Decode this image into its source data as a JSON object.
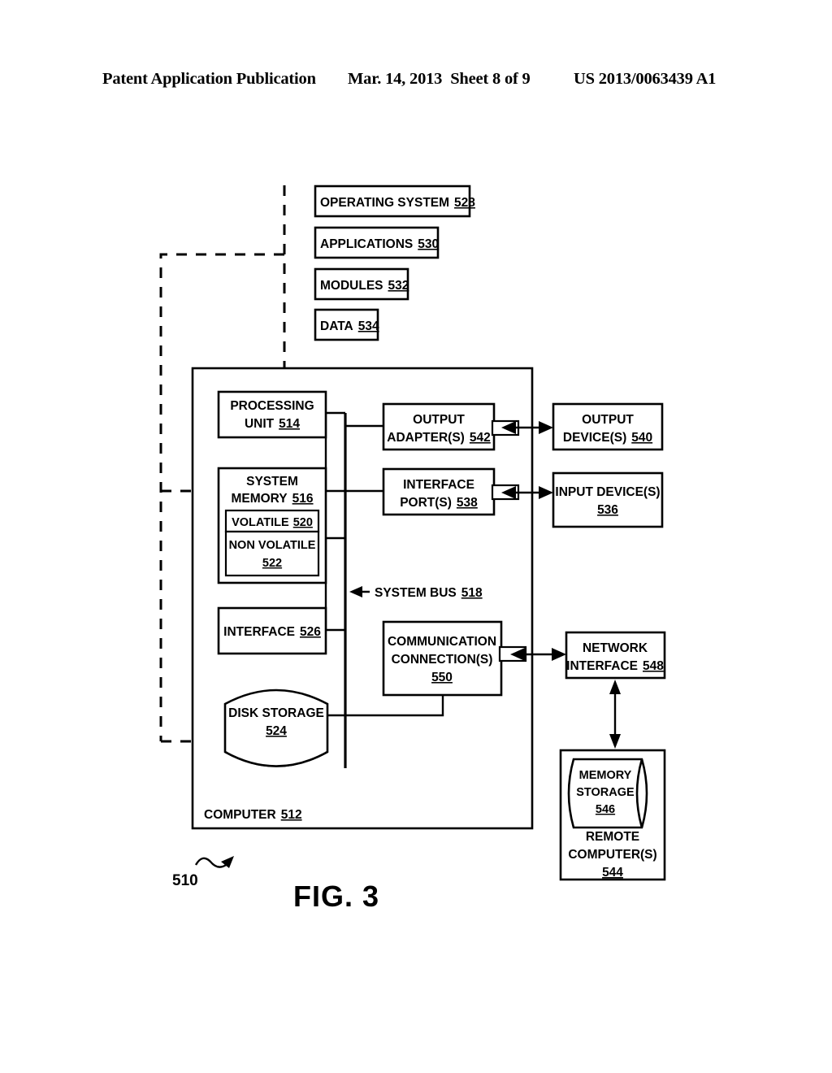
{
  "header": {
    "left": "Patent Application Publication",
    "date": "Mar. 14, 2013",
    "sheet": "Sheet 8 of 9",
    "publication_number": "US 2013/0063439 A1"
  },
  "figure": {
    "caption": "FIG. 3",
    "system_ref": "510",
    "bus_label": "SYSTEM BUS",
    "bus_ref": "518",
    "computer_label": "COMPUTER",
    "computer_ref": "512"
  },
  "software_blocks": [
    {
      "label": "OPERATING SYSTEM",
      "ref": "528"
    },
    {
      "label": "APPLICATIONS",
      "ref": "530"
    },
    {
      "label": "MODULES",
      "ref": "532"
    },
    {
      "label": "DATA",
      "ref": "534"
    }
  ],
  "computer_blocks": {
    "processing_unit": {
      "line1": "PROCESSING",
      "line2": "UNIT",
      "ref": "514"
    },
    "system_memory": {
      "line1": "SYSTEM",
      "line2": "MEMORY",
      "ref": "516"
    },
    "volatile": {
      "label": "VOLATILE",
      "ref": "520"
    },
    "non_volatile": {
      "line1": "NON VOLATILE",
      "ref": "522"
    },
    "interface": {
      "label": "INTERFACE",
      "ref": "526"
    },
    "disk_storage": {
      "label": "DISK STORAGE",
      "ref": "524"
    },
    "output_adapters": {
      "line1": "OUTPUT",
      "line2": "ADAPTER(S)",
      "ref": "542"
    },
    "interface_ports": {
      "line1": "INTERFACE",
      "line2": "PORT(S)",
      "ref": "538"
    },
    "communication_connections": {
      "line1": "COMMUNICATION",
      "line2": "CONNECTION(S)",
      "ref": "550"
    }
  },
  "external_blocks": {
    "output_devices": {
      "line1": "OUTPUT",
      "line2": "DEVICE(S)",
      "ref": "540"
    },
    "input_devices": {
      "line1": "INPUT DEVICE(S)",
      "ref": "536"
    },
    "network_interface": {
      "line1": "NETWORK",
      "line2": "INTERFACE",
      "ref": "548"
    },
    "memory_storage": {
      "line1": "MEMORY",
      "line2": "STORAGE",
      "ref": "546"
    },
    "remote_computers": {
      "line1": "REMOTE",
      "line2": "COMPUTER(S)",
      "ref": "544"
    }
  },
  "colors": {
    "ink": "#000000",
    "paper": "#ffffff"
  }
}
